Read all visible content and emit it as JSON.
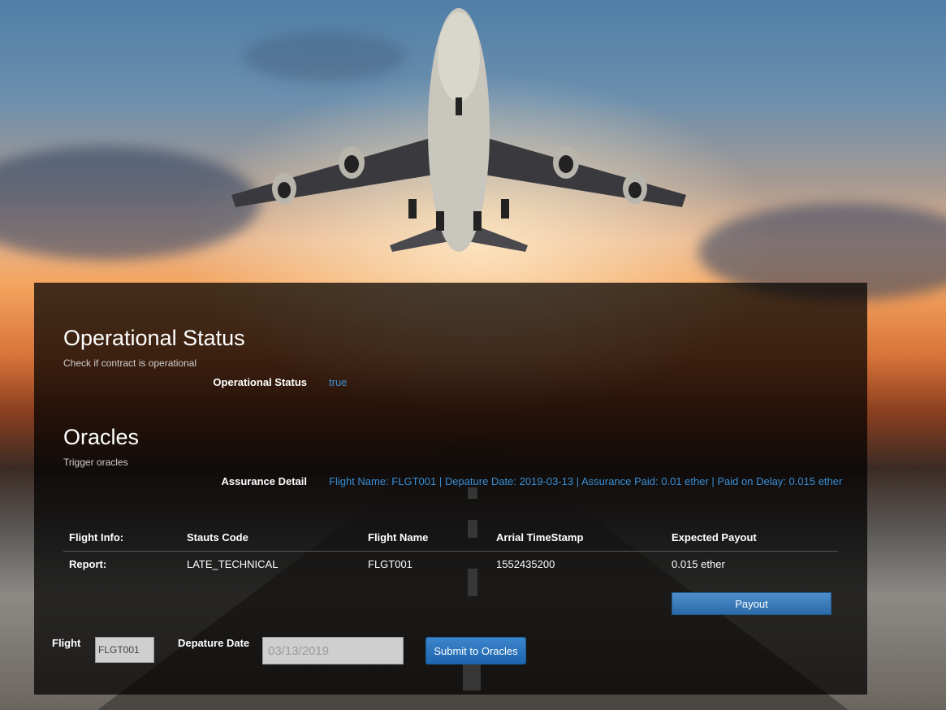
{
  "status_section": {
    "title": "Operational Status",
    "subtitle": "Check if contract is operational",
    "label": "Operational Status",
    "value": "true"
  },
  "oracles_section": {
    "title": "Oracles",
    "subtitle": "Trigger oracles",
    "label": "Assurance Detail",
    "value": "Flight Name: FLGT001 | Depature Date: 2019-03-13 | Assurance Paid: 0.01 ether | Paid on Delay: 0.015 ether"
  },
  "table": {
    "headers": [
      "Flight Info:",
      "Stauts Code",
      "Flight Name",
      "Arrial TimeStamp",
      "Expected Payout"
    ],
    "row": [
      "Report:",
      "LATE_TECHNICAL",
      "FLGT001",
      "1552435200",
      "0.015 ether"
    ]
  },
  "payout_button": "Payout",
  "form": {
    "flight_label": "Flight",
    "flight_value": "FLGT001",
    "date_label": "Depature Date",
    "date_value": "03/13/2019",
    "submit_label": "Submit to Oracles"
  },
  "colors": {
    "link_blue": "#3a8fd6",
    "button_blue": "#2a6aa8"
  }
}
